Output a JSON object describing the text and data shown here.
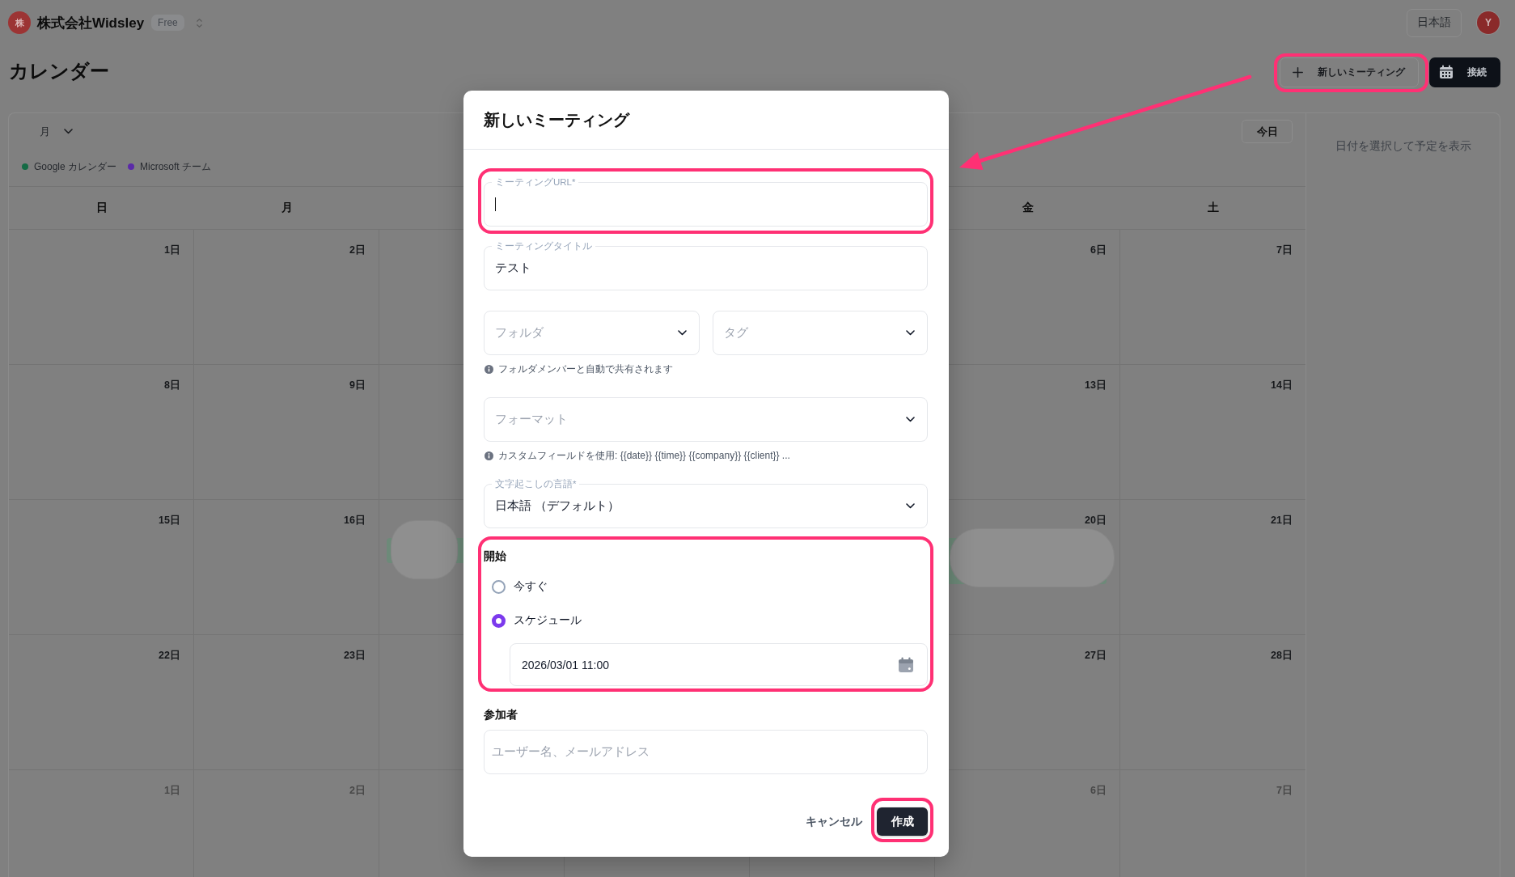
{
  "header": {
    "org_initial": "株",
    "org_name": "株式会社Widsley",
    "plan": "Free",
    "language": "日本語",
    "user_initial": "Y"
  },
  "page": {
    "title": "カレンダー",
    "actions": [
      {
        "kind": "create",
        "label": "新しいミーティング",
        "highlighted": true
      },
      {
        "kind": "connect",
        "label": "接続",
        "highlighted": false
      }
    ]
  },
  "calendar": {
    "view": "月",
    "today": "今日",
    "legend": [
      {
        "label": "Google カレンダー",
        "color": "#156b45"
      },
      {
        "label": "Microsoft チーム",
        "color": "#5b2aa8"
      }
    ],
    "weekdays": {
      "sun": "日",
      "mon": "月",
      "fri": "金",
      "sat": "土"
    },
    "weeks": [
      {
        "cells": [
          {
            "day": "1日",
            "muted": false
          },
          {
            "day": "2日",
            "muted": false
          },
          null,
          null,
          null,
          {
            "day": "6日",
            "muted": false
          },
          {
            "day": "7日",
            "muted": false
          }
        ]
      },
      {
        "cells": [
          {
            "day": "8日",
            "muted": false
          },
          {
            "day": "9日",
            "muted": false
          },
          null,
          null,
          null,
          {
            "day": "13日",
            "muted": false
          },
          {
            "day": "14日",
            "muted": false
          }
        ]
      },
      {
        "cells": [
          {
            "day": "15日",
            "muted": false
          },
          {
            "day": "16日",
            "muted": false
          },
          {
            "events": [
              {
                "kind": "oneline",
                "color": "#6d8a79",
                "redacted": true
              }
            ]
          },
          null,
          null,
          {
            "day": "20日",
            "muted": false,
            "events": [
              {
                "kind": "twoline",
                "color": "#6d8a79",
                "redacted": true
              }
            ]
          },
          {
            "day": "21日",
            "muted": false
          }
        ]
      },
      {
        "cells": [
          {
            "day": "22日",
            "muted": false
          },
          {
            "day": "23日",
            "muted": false
          },
          null,
          null,
          null,
          {
            "day": "27日",
            "muted": false
          },
          {
            "day": "28日",
            "muted": false
          }
        ]
      },
      {
        "cells": [
          {
            "day": "1日",
            "muted": true
          },
          {
            "day": "2日",
            "muted": true
          },
          null,
          null,
          null,
          {
            "day": "6日",
            "muted": true
          },
          {
            "day": "7日",
            "muted": true
          }
        ]
      }
    ],
    "side_panel": "日付を選択して予定を表示"
  },
  "dialog": {
    "title": "新しいミーティング",
    "fields": [
      {
        "kind": "text",
        "label": "ミーティングURL*",
        "focused": true,
        "highlighted": true
      },
      {
        "kind": "text",
        "label": "ミーティングタイトル",
        "value": "テスト",
        "focused": false,
        "highlighted": false
      },
      {
        "kind": "select_pair",
        "items": [
          {
            "placeholder": "フォルダ"
          },
          {
            "placeholder": "タグ"
          }
        ],
        "hint": "フォルダメンバーと自動で共有されます"
      },
      {
        "kind": "select",
        "placeholder": "フォーマット",
        "hint": "カスタムフィールドを使用: {{date}} {{time}} {{company}} {{client}} ..."
      },
      {
        "kind": "select",
        "label": "文字起こしの言語*",
        "value": "日本語 （デフォルト）"
      }
    ],
    "start": {
      "label": "開始",
      "highlighted": true,
      "options": [
        {
          "label": "今すぐ",
          "selected": false
        },
        {
          "label": "スケジュール",
          "selected": true
        }
      ],
      "datetime": "2026/03/01 11:00"
    },
    "participants": {
      "label": "参加者",
      "placeholder": "ユーザー名、メールアドレス"
    },
    "buttons": [
      {
        "kind": "cancel",
        "label": "キャンセル",
        "highlighted": false
      },
      {
        "kind": "submit",
        "label": "作成",
        "highlighted": true
      }
    ]
  }
}
